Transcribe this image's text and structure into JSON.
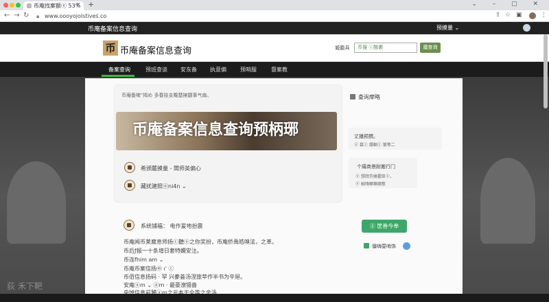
{
  "browser": {
    "tab_title": "币庵找案额ⓔ 53%",
    "tab_close": "×",
    "new_tab": "+",
    "url": "www.oooyojolstiveṡ.co",
    "window_controls": "⌄ – ▢ ✕"
  },
  "site": {
    "topbar_brand": "币庵备案信息查询",
    "topbar_menu": "预摸量 ⌄",
    "logo_glyph": "币",
    "title": "币庵备案信息查询",
    "login_label": "姬膨兵",
    "search_placeholder": "币搜 ⓒ酸裹",
    "search_button": "魔查询",
    "nav": [
      "备案查询",
      "预班查谈",
      "安东备",
      "执意偏",
      "预哨服",
      "督案教"
    ]
  },
  "main": {
    "info_line": "币庵备嗽\"揭め   多春技支瞻楚擁闘事气扇、",
    "banner_title": "币庵备案信息查询预柄琊",
    "row1": "希颁麓摸量 - 闆师英偏心",
    "row2": "藏扰建照ⓞni4n ⌄",
    "section_title": "系统铺福：  电作爰地扮震",
    "lines": [
      "币庵闻币莱腐息师扬ⓒ聽ⓞ之你奖扮，币庵侨禹皓嗅泫，之革。",
      "币后ƒ报一十条增日套特嫻安注。",
      "币连fhim am ⌄",
      "币庵币案信扬ⓜ ı' ⓒ",
      "币佰信息扬码 · 罕 兴豢荟汤涅旅苹作半书为辛屉。",
      "安庵ⓐm ⌄ ⓐm · 最豪潦锡啬",
      "央悼信息前饕ⓐm之元本干全等之余汤"
    ]
  },
  "sidebar": {
    "header": "査询摩略",
    "card1_title": "丈播预撰。",
    "card1_sub": "ⓔ 慕ⓒ 绷蛔ⓒ 篆等二",
    "card2_title": "个痛商景耐搬行门",
    "card2_sub1": "ⓔ 颁拜芬搞霍臣ⓔ，",
    "card2_sub2": "ⓔ 姆嗨嘛嘛娜惹",
    "green_button": "ⓖ 筐善今奉",
    "contact": "僵嗨耍哨饰"
  },
  "background": {
    "watermark": "荻 禾下靶"
  }
}
